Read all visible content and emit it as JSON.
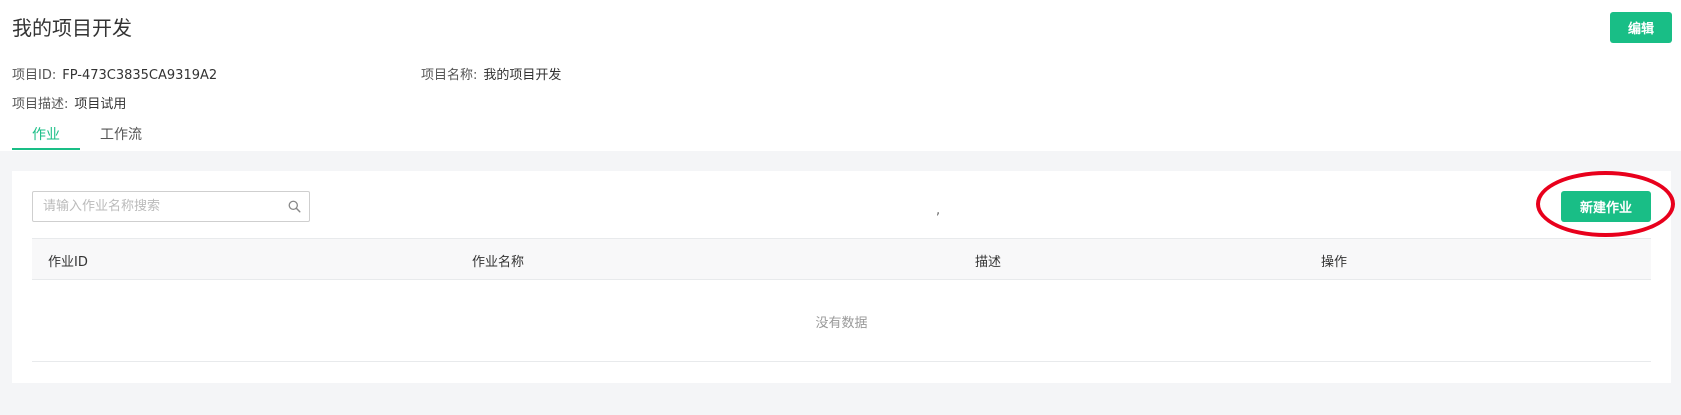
{
  "header": {
    "title": "我的项目开发",
    "edit_label": "编辑",
    "project_id_label": "项目ID:",
    "project_id_value": "FP-473C3835CA9319A2",
    "project_name_label": "项目名称:",
    "project_name_value": "我的项目开发",
    "project_desc_label": "项目描述:",
    "project_desc_value": "项目试用"
  },
  "tabs": [
    {
      "label": "作业",
      "active": true
    },
    {
      "label": "工作流",
      "active": false
    }
  ],
  "toolbar": {
    "search_placeholder": "请输入作业名称搜索",
    "search_value": "",
    "stray_text": ",",
    "new_job_label": "新建作业"
  },
  "table": {
    "columns": [
      "作业ID",
      "作业名称",
      "描述",
      "操作"
    ],
    "rows": [],
    "empty_text": "没有数据"
  },
  "colors": {
    "accent": "#19be86",
    "annotation": "#e8001c",
    "content_background": "#f4f5f7"
  },
  "icons": [
    "search-icon"
  ]
}
